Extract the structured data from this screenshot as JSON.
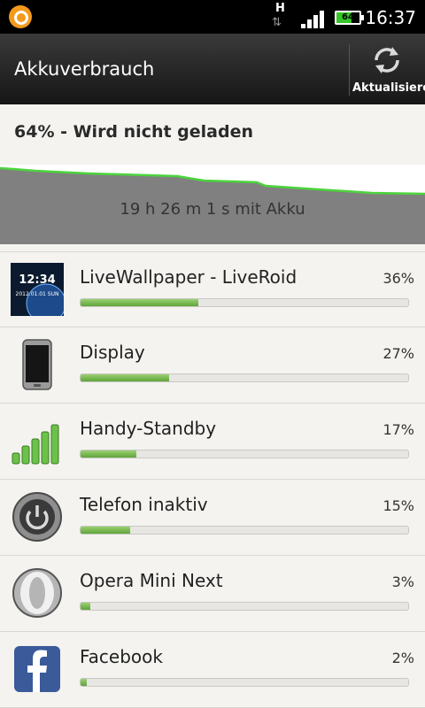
{
  "status_bar": {
    "network_type": "H",
    "battery_level": "64",
    "battery_fraction": 0.64,
    "clock": "16:37",
    "accent": "#37c629"
  },
  "action_bar": {
    "title": "Akkuverbrauch",
    "refresh_label": "Aktualisieren",
    "refresh_icon": "refresh-icon"
  },
  "battery": {
    "status": "64% - Wird nicht geladen",
    "graph_label": "19 h 26 m 1 s mit Akku",
    "graph_line_color": "#4cd43c"
  },
  "items": [
    {
      "name": "LiveWallpaper - LiveRoid",
      "percent": "36%",
      "fraction": 0.36,
      "icon": "live-wallpaper-icon",
      "icon_time": "12:34",
      "icon_date": "2012.01.01 SUN"
    },
    {
      "name": "Display",
      "percent": "27%",
      "fraction": 0.27,
      "icon": "display-icon"
    },
    {
      "name": "Handy-Standby",
      "percent": "17%",
      "fraction": 0.17,
      "icon": "signal-bars-icon"
    },
    {
      "name": "Telefon inaktiv",
      "percent": "15%",
      "fraction": 0.15,
      "icon": "power-icon"
    },
    {
      "name": "Opera Mini Next",
      "percent": "3%",
      "fraction": 0.03,
      "icon": "opera-icon"
    },
    {
      "name": "Facebook",
      "percent": "2%",
      "fraction": 0.02,
      "icon": "facebook-icon"
    }
  ]
}
